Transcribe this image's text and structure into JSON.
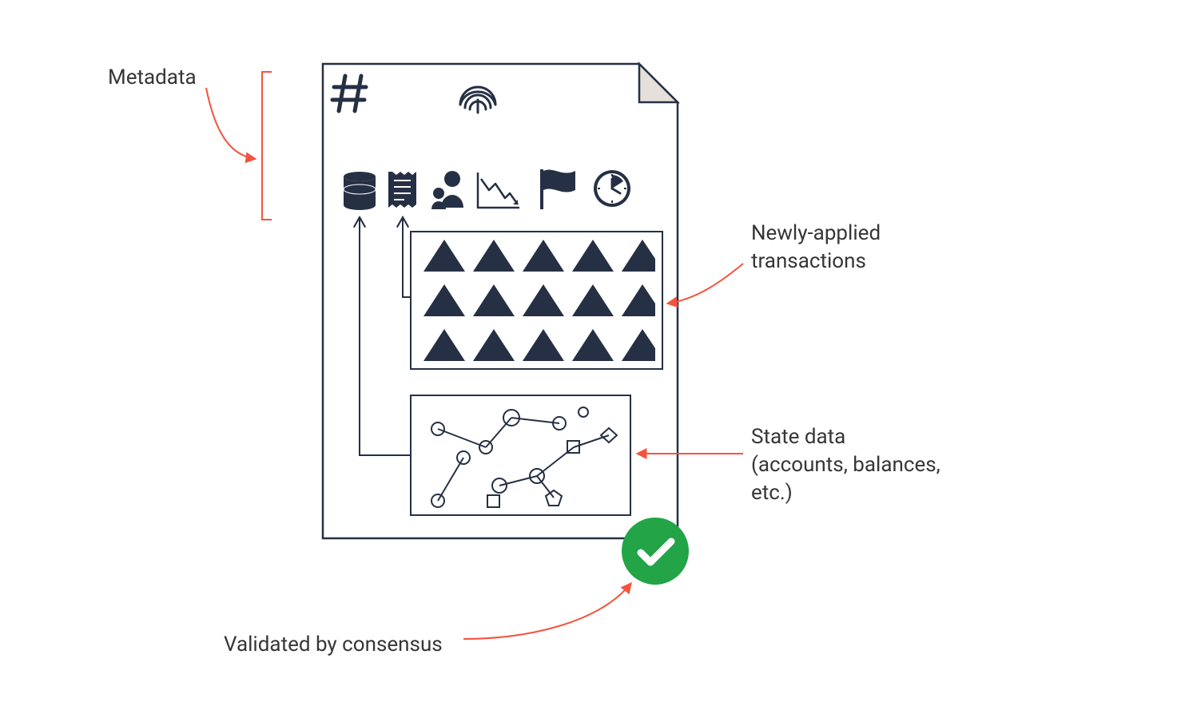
{
  "labels": {
    "metadata": "Metadata",
    "transactions": "Newly-applied\ntransactions",
    "state": "State data\n(accounts, balances,\netc.)",
    "validated": "Validated by consensus"
  },
  "colors": {
    "outline": "#263044",
    "fill": "#263044",
    "arrow": "#F5533D",
    "accent_green": "#22A447",
    "paper_fold": "#E5E1DA",
    "white": "#FFFFFF"
  },
  "icons": {
    "header": [
      "hash-icon",
      "fingerprint-icon"
    ],
    "row": [
      "database-icon",
      "receipt-icon",
      "people-icon",
      "chart-down-icon",
      "flag-icon",
      "clock-icon"
    ]
  },
  "sections": {
    "transactions_grid": {
      "rows": 3,
      "cols": 5,
      "shape": "triangle"
    },
    "state_data": "scatter-network"
  },
  "badge": "checkmark"
}
